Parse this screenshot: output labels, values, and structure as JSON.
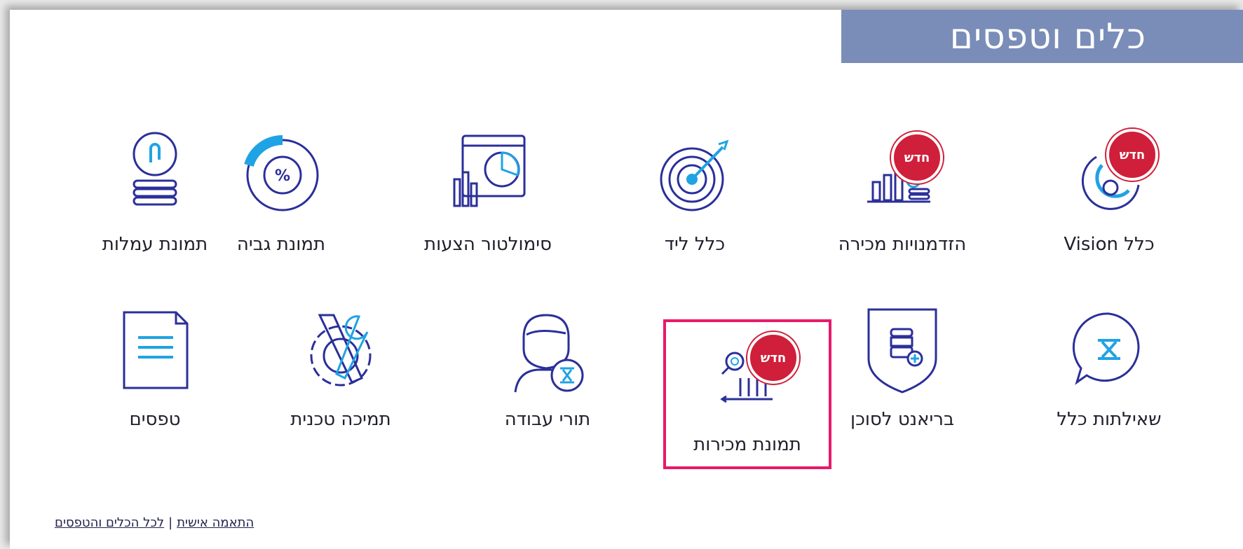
{
  "header": {
    "title": "כלים וטפסים"
  },
  "badge_text": "חדש",
  "tiles_row1": [
    {
      "label": "כלל Vision",
      "icon": "vision-icon",
      "new": true
    },
    {
      "label": "הזדמנויות מכירה",
      "icon": "sales-opportunities-icon",
      "new": true
    },
    {
      "label": "כלל ליד",
      "icon": "target-icon",
      "new": false
    },
    {
      "label": "סימולטור הצעות",
      "icon": "offer-simulator-icon",
      "new": false
    },
    {
      "label": "תמונת גביה",
      "icon": "collection-percent-icon",
      "new": false
    },
    {
      "label": "תמונת עמלות",
      "icon": "commission-coins-icon",
      "new": false
    }
  ],
  "tiles_row2": [
    {
      "label": "שאילתות כלל",
      "icon": "chat-bubble-icon",
      "new": false
    },
    {
      "label": "בריאנט לסוכן",
      "icon": "shield-db-icon",
      "new": false
    },
    {
      "label": "תמונת מכירות",
      "icon": "sales-chart-icon",
      "new": true,
      "selected": true
    },
    {
      "label": "תורי עבודה",
      "icon": "agent-queue-icon",
      "new": false
    },
    {
      "label": "תמיכה טכנית",
      "icon": "tech-support-icon",
      "new": false
    },
    {
      "label": "טפסים",
      "icon": "document-icon",
      "new": false
    }
  ],
  "footer": {
    "link_personal": "התאמה אישית",
    "separator": "|",
    "link_all": "לכל הכלים והטפסים"
  },
  "colors": {
    "title_bar": "#7a8db8",
    "icon_stroke": "#2b2f9a",
    "icon_accent": "#1fa3e4",
    "badge": "#cf1f3a",
    "highlight": "#e8196a"
  }
}
